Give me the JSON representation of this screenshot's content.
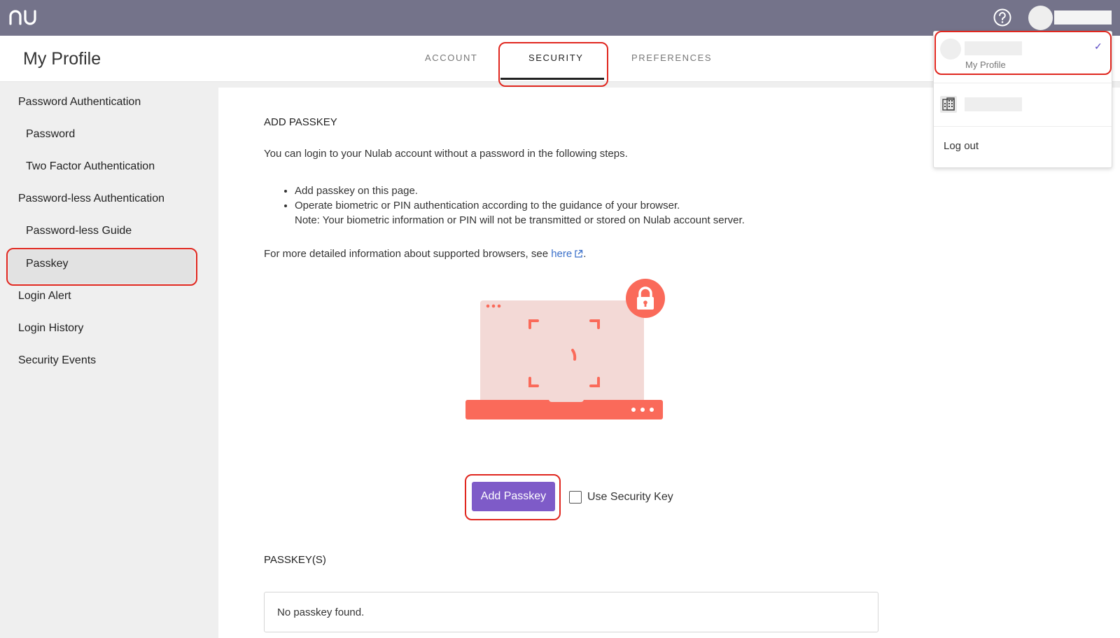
{
  "header": {
    "logo_text": "nu",
    "help_icon": "help-circle-icon"
  },
  "profile": {
    "title": "My Profile",
    "tabs": [
      {
        "label": "ACCOUNT"
      },
      {
        "label": "SECURITY",
        "active": true
      },
      {
        "label": "PREFERENCES"
      }
    ]
  },
  "sidebar": {
    "items": [
      {
        "label": "Password Authentication"
      },
      {
        "label": "Password"
      },
      {
        "label": "Two Factor Authentication"
      },
      {
        "label": "Password-less Authentication"
      },
      {
        "label": "Password-less Guide"
      },
      {
        "label": "Passkey",
        "active": true
      },
      {
        "label": "Login Alert"
      },
      {
        "label": "Login History"
      },
      {
        "label": "Security Events"
      }
    ]
  },
  "main": {
    "heading": "ADD PASSKEY",
    "intro": "You can login to your Nulab account without a password in the following steps.",
    "steps": [
      "Add passkey on this page.",
      "Operate biometric or PIN authentication according to the guidance of your browser.",
      "Note: Your biometric information or PIN will not be transmitted or stored on Nulab account server."
    ],
    "more_info_prefix": "For more detailed information about supported browsers, see ",
    "more_info_link": "here",
    "more_info_suffix": ".",
    "add_button": "Add Passkey",
    "security_key_label": "Use Security Key",
    "list_heading": "PASSKEY(S)",
    "empty_message": "No passkey found."
  },
  "dropdown": {
    "profile_sub": "My Profile",
    "logout": "Log out"
  },
  "colors": {
    "topbar": "#74738a",
    "accent": "#7e5bc8",
    "highlight": "#e0271f",
    "illustration": "#fa6a5a",
    "link": "#3a6fc9"
  }
}
